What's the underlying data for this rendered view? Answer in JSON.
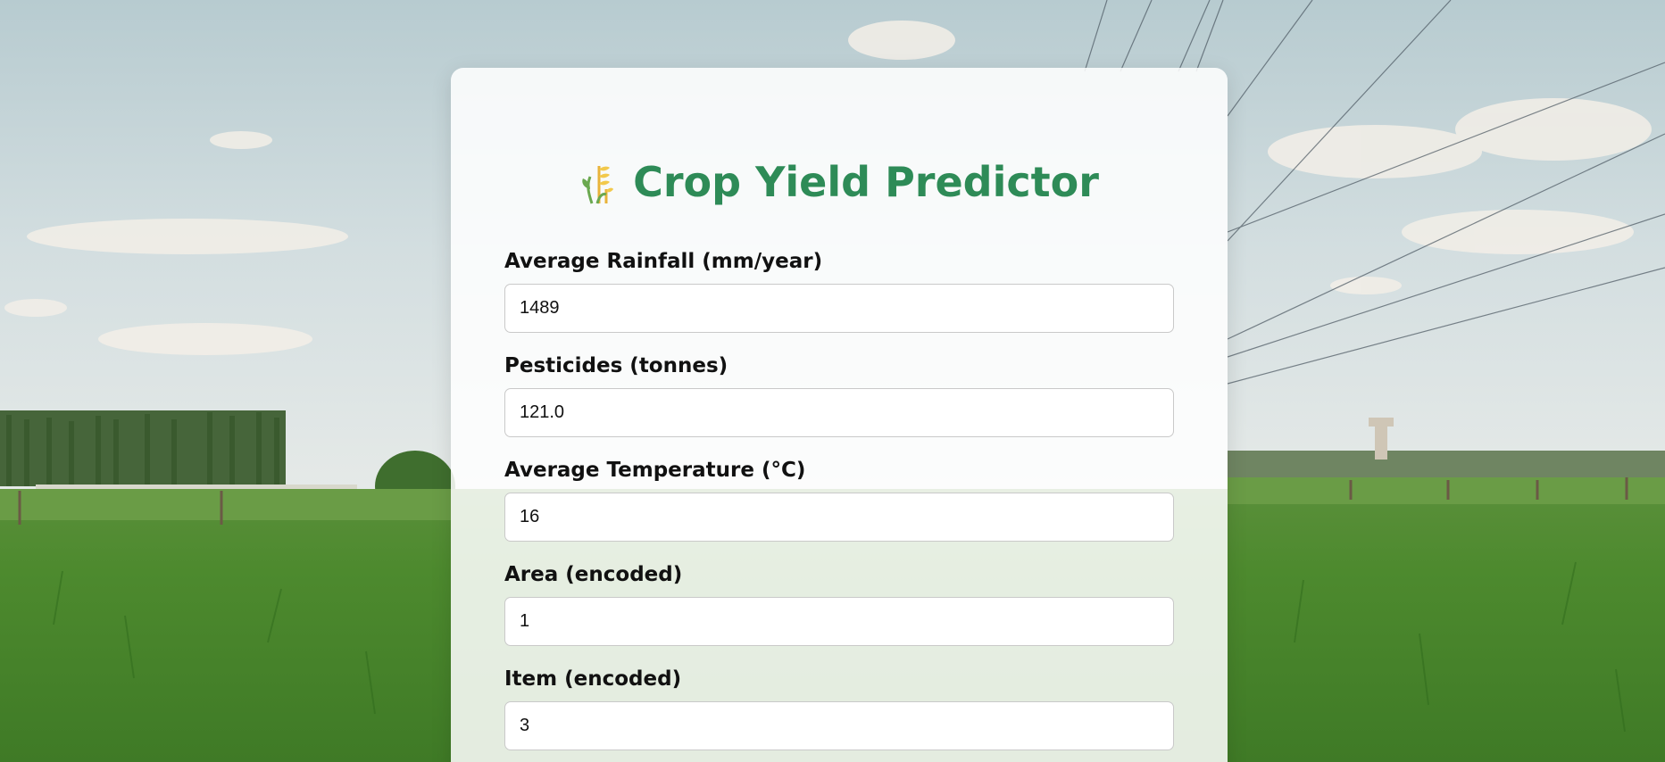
{
  "app": {
    "title": "Crop Yield Predictor",
    "icon": "wheat-icon",
    "accent_color": "#2e8b57"
  },
  "form": {
    "fields": [
      {
        "label": "Average Rainfall (mm/year)",
        "value": "1489"
      },
      {
        "label": "Pesticides (tonnes)",
        "value": "121.0"
      },
      {
        "label": "Average Temperature (°C)",
        "value": "16"
      },
      {
        "label": "Area (encoded)",
        "value": "1"
      },
      {
        "label": "Item (encoded)",
        "value": "3"
      }
    ]
  }
}
